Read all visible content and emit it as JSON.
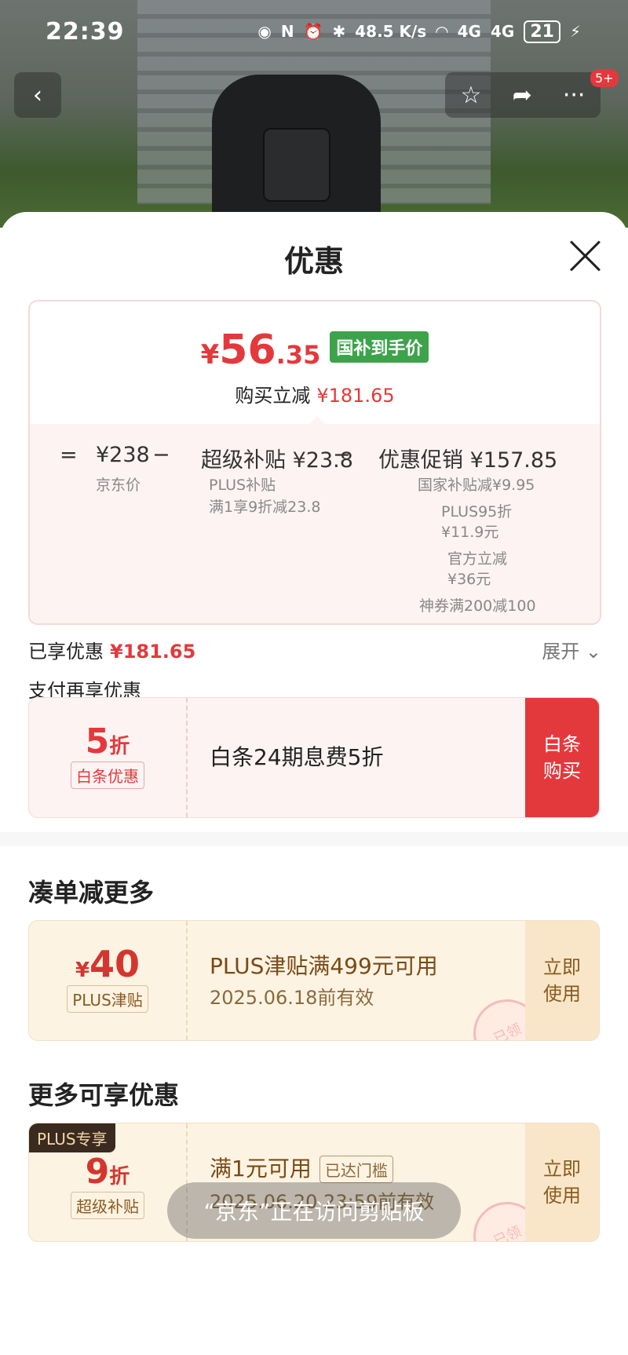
{
  "status_bar": {
    "time": "22:39",
    "net_speed": "48.5 K/s",
    "signal_1": "4G",
    "signal_2": "4G",
    "battery": "21"
  },
  "nav": {
    "badge": "5+"
  },
  "sheet": {
    "title": "优惠"
  },
  "price": {
    "currency": "¥",
    "final_int": "56",
    "final_dec": ".35",
    "tag": "国补到手价",
    "reduce_label": "购买立减",
    "reduce_value": "¥181.65",
    "equals": "=",
    "minus": "−",
    "jd_price": "¥238",
    "jd_price_label": "京东价",
    "subsidy": "超级补贴 ¥23.8",
    "subsidy_detail_1": "PLUS补贴",
    "subsidy_detail_2": "满1享9折减23.8",
    "promo": "优惠促销 ¥157.85",
    "promo_detail_1": "国家补贴减¥9.95",
    "promo_detail_2": "PLUS95折",
    "promo_detail_3": "¥11.9元",
    "promo_detail_4": "官方立减",
    "promo_detail_5": "¥36元",
    "promo_detail_6": "神券满200减100"
  },
  "enjoyed": {
    "label": "已享优惠",
    "value": "¥181.65",
    "expand": "展开"
  },
  "pay": {
    "label": "支付再享优惠",
    "discount_num": "5",
    "discount_unit": "折",
    "tag": "白条优惠",
    "desc": "白条24期息费5折",
    "action_line1": "白条",
    "action_line2": "购买"
  },
  "combine": {
    "title": "凑单减更多",
    "amount_symbol": "¥",
    "amount": "40",
    "tag": "PLUS津贴",
    "desc": "PLUS津贴满499元可用",
    "expiry": "2025.06.18前有效",
    "action_line1": "立即",
    "action_line2": "使用",
    "stamp": "已领"
  },
  "more": {
    "title": "更多可享优惠",
    "plus_tag": "PLUS专享",
    "discount_num": "9",
    "discount_unit": "折",
    "tag": "超级补贴",
    "desc": "满1元可用",
    "threshold": "已达门槛",
    "expiry": "2025.06.20 23:59前有效",
    "action_line1": "立即",
    "action_line2": "使用",
    "stamp": "已领"
  },
  "toast": "“京东”正在访问剪贴板"
}
